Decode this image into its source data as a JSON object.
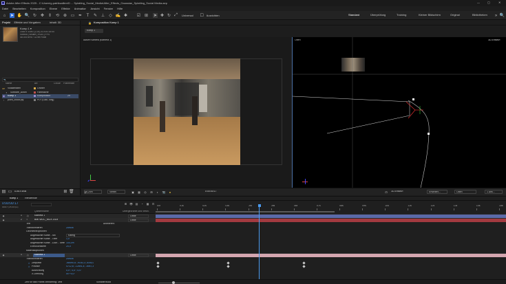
{
  "titlebar": {
    "app_title": "Adobe After Effects 2025 - C:\\Users\\g.patriksaillen\\D ... Splatting_Social_Media\\After_Effects_Gaussian_Splatting_Social Media.aep",
    "window_controls": [
      "—",
      "▢",
      "✕"
    ]
  },
  "menu": [
    "Datei",
    "Bearbeiten",
    "Komposition",
    "Ebene",
    "Effekte",
    "Animation",
    "Ansicht",
    "Fenster",
    "Hilfe"
  ],
  "toolbar": {
    "universal_label": "Universal",
    "snap_label": "Ausrichten"
  },
  "workspaces": [
    "Standard",
    "Überprüfung",
    "Training",
    "Kleiner Bildschirm",
    "Original",
    "Bibliotheken"
  ],
  "project_panel": {
    "tabs": [
      "Projekt",
      "Effekte und Vorgaben",
      "Inhalt: 3D"
    ],
    "info_name": "Komp 1 ▾",
    "info_lines": [
      "1080 x 1080 (1,00) Δ 0:00:15:00",
      "Vorbild | Wolke | RGB | FPS",
      "48.000 kHz / 32 bit Float"
    ],
    "search_placeholder": "🔍",
    "columns": [
      "Name",
      "Art",
      "Größe",
      "Framerate"
    ],
    "items": [
      {
        "name": "Volkliteraten",
        "type": "Ordner",
        "color": "#d6a94a"
      },
      {
        "name": "Sofware_Acton",
        "type": "Farbfläche",
        "color": "#c0504d"
      },
      {
        "name": "Komp 1",
        "type": "Komposition",
        "color": "#9b8ad0",
        "fps": "29"
      },
      {
        "name": "point_cloud.ply",
        "type": "PLY (Gau..Seg)",
        "color": "#808080"
      }
    ],
    "footer_bpc": "8-Bit-Kanal"
  },
  "composition_panel": {
    "tab_label": "Komposition Komp 1",
    "subtab": "Komp 1",
    "left_view_label": "Aktive Kamera (Kamera 1)",
    "right_view_label": "Oben",
    "renderer_label": "3D-Entwurf",
    "bottom_bar": {
      "zoom": "6,25%",
      "resolution": "Viertel",
      "timecode": "0:00:00:17",
      "draft_label": "3D-Entwurf",
      "extended_label": "Erweitert...",
      "view_label": "Oben",
      "views_count": "1 Ans..."
    }
  },
  "timeline": {
    "tabs": [
      "Komp 1",
      "Renderliste"
    ],
    "timecode": "0:00:00:17",
    "timecode_sub": "00017 (25.00 fps)",
    "col_header": "Quellenname",
    "parent_header": "Übergeordnet und verkn.",
    "ruler_ticks": [
      "00f",
      "01s",
      "02s",
      "03s",
      "04s",
      "05s",
      "06s",
      "07s",
      "08s",
      "09s",
      "10s",
      "11s",
      "12s",
      "13s",
      "14s",
      "15s"
    ],
    "playhead_fraction": 0.073,
    "layers": [
      {
        "num": "1",
        "name": "Kamera 1",
        "parent": "Ohne",
        "color": "#a6a6a6"
      },
      {
        "name": "BMI WOC_MOX 2024",
        "num": "2",
        "parent": "Ohne",
        "color": "#c0504d"
      }
    ],
    "properties": [
      {
        "label": "Text",
        "value": ""
      },
      {
        "label": "Transformieren",
        "value": "Zurück"
      },
      {
        "label": "Geometrieoptionen",
        "value": ""
      },
      {
        "label": "Abgeflachte Kante - Stil",
        "value": "Kantig"
      },
      {
        "label": "Abgeflachte Kante - Tiefe",
        "value": "1,0"
      },
      {
        "label": "Abgeflachte Kante - Loch - Tiefe",
        "value": "100,0%"
      },
      {
        "label": "Extrusionstiefe",
        "value": "20,0"
      },
      {
        "label": "Materialoptionen",
        "value": ""
      }
    ],
    "cam_properties": [
      {
        "label": "Transformieren",
        "value": "Zurück"
      },
      {
        "label": "Zielpunkt",
        "value": "-58490,5; -9151,0; 2004,0"
      },
      {
        "label": "Position",
        "value": "4712,6; -12691,4; -4957,3"
      },
      {
        "label": "Ausrichtung",
        "value": "0,0°; 0,0°; 0,0°"
      },
      {
        "label": "X-Drehung",
        "value": "0x +0,0°"
      }
    ],
    "footer_left": "Zeit für das Frame-Rendering: 3ms",
    "footer_mode": "Schalter/Modi",
    "parent_none": "Ohne",
    "annotation_label": "Animieren:"
  }
}
